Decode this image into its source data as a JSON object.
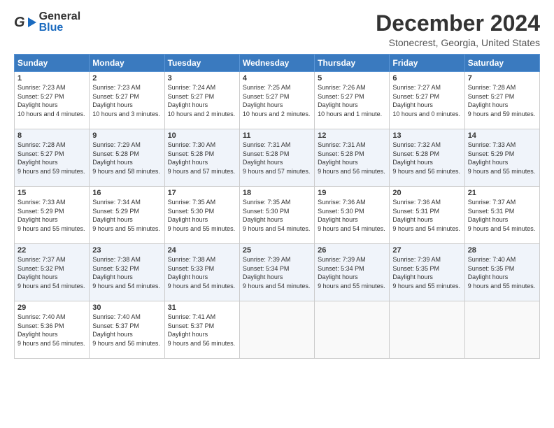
{
  "header": {
    "logo_general": "General",
    "logo_blue": "Blue",
    "title": "December 2024",
    "location": "Stonecrest, Georgia, United States"
  },
  "columns": [
    "Sunday",
    "Monday",
    "Tuesday",
    "Wednesday",
    "Thursday",
    "Friday",
    "Saturday"
  ],
  "weeks": [
    [
      {
        "day": "1",
        "sunrise": "7:23 AM",
        "sunset": "5:27 PM",
        "daylight": "10 hours and 4 minutes."
      },
      {
        "day": "2",
        "sunrise": "7:23 AM",
        "sunset": "5:27 PM",
        "daylight": "10 hours and 3 minutes."
      },
      {
        "day": "3",
        "sunrise": "7:24 AM",
        "sunset": "5:27 PM",
        "daylight": "10 hours and 2 minutes."
      },
      {
        "day": "4",
        "sunrise": "7:25 AM",
        "sunset": "5:27 PM",
        "daylight": "10 hours and 2 minutes."
      },
      {
        "day": "5",
        "sunrise": "7:26 AM",
        "sunset": "5:27 PM",
        "daylight": "10 hours and 1 minute."
      },
      {
        "day": "6",
        "sunrise": "7:27 AM",
        "sunset": "5:27 PM",
        "daylight": "10 hours and 0 minutes."
      },
      {
        "day": "7",
        "sunrise": "7:28 AM",
        "sunset": "5:27 PM",
        "daylight": "9 hours and 59 minutes."
      }
    ],
    [
      {
        "day": "8",
        "sunrise": "7:28 AM",
        "sunset": "5:27 PM",
        "daylight": "9 hours and 59 minutes."
      },
      {
        "day": "9",
        "sunrise": "7:29 AM",
        "sunset": "5:28 PM",
        "daylight": "9 hours and 58 minutes."
      },
      {
        "day": "10",
        "sunrise": "7:30 AM",
        "sunset": "5:28 PM",
        "daylight": "9 hours and 57 minutes."
      },
      {
        "day": "11",
        "sunrise": "7:31 AM",
        "sunset": "5:28 PM",
        "daylight": "9 hours and 57 minutes."
      },
      {
        "day": "12",
        "sunrise": "7:31 AM",
        "sunset": "5:28 PM",
        "daylight": "9 hours and 56 minutes."
      },
      {
        "day": "13",
        "sunrise": "7:32 AM",
        "sunset": "5:28 PM",
        "daylight": "9 hours and 56 minutes."
      },
      {
        "day": "14",
        "sunrise": "7:33 AM",
        "sunset": "5:29 PM",
        "daylight": "9 hours and 55 minutes."
      }
    ],
    [
      {
        "day": "15",
        "sunrise": "7:33 AM",
        "sunset": "5:29 PM",
        "daylight": "9 hours and 55 minutes."
      },
      {
        "day": "16",
        "sunrise": "7:34 AM",
        "sunset": "5:29 PM",
        "daylight": "9 hours and 55 minutes."
      },
      {
        "day": "17",
        "sunrise": "7:35 AM",
        "sunset": "5:30 PM",
        "daylight": "9 hours and 55 minutes."
      },
      {
        "day": "18",
        "sunrise": "7:35 AM",
        "sunset": "5:30 PM",
        "daylight": "9 hours and 54 minutes."
      },
      {
        "day": "19",
        "sunrise": "7:36 AM",
        "sunset": "5:30 PM",
        "daylight": "9 hours and 54 minutes."
      },
      {
        "day": "20",
        "sunrise": "7:36 AM",
        "sunset": "5:31 PM",
        "daylight": "9 hours and 54 minutes."
      },
      {
        "day": "21",
        "sunrise": "7:37 AM",
        "sunset": "5:31 PM",
        "daylight": "9 hours and 54 minutes."
      }
    ],
    [
      {
        "day": "22",
        "sunrise": "7:37 AM",
        "sunset": "5:32 PM",
        "daylight": "9 hours and 54 minutes."
      },
      {
        "day": "23",
        "sunrise": "7:38 AM",
        "sunset": "5:32 PM",
        "daylight": "9 hours and 54 minutes."
      },
      {
        "day": "24",
        "sunrise": "7:38 AM",
        "sunset": "5:33 PM",
        "daylight": "9 hours and 54 minutes."
      },
      {
        "day": "25",
        "sunrise": "7:39 AM",
        "sunset": "5:34 PM",
        "daylight": "9 hours and 54 minutes."
      },
      {
        "day": "26",
        "sunrise": "7:39 AM",
        "sunset": "5:34 PM",
        "daylight": "9 hours and 55 minutes."
      },
      {
        "day": "27",
        "sunrise": "7:39 AM",
        "sunset": "5:35 PM",
        "daylight": "9 hours and 55 minutes."
      },
      {
        "day": "28",
        "sunrise": "7:40 AM",
        "sunset": "5:35 PM",
        "daylight": "9 hours and 55 minutes."
      }
    ],
    [
      {
        "day": "29",
        "sunrise": "7:40 AM",
        "sunset": "5:36 PM",
        "daylight": "9 hours and 56 minutes."
      },
      {
        "day": "30",
        "sunrise": "7:40 AM",
        "sunset": "5:37 PM",
        "daylight": "9 hours and 56 minutes."
      },
      {
        "day": "31",
        "sunrise": "7:41 AM",
        "sunset": "5:37 PM",
        "daylight": "9 hours and 56 minutes."
      },
      null,
      null,
      null,
      null
    ]
  ],
  "labels": {
    "sunrise": "Sunrise:",
    "sunset": "Sunset:",
    "daylight": "Daylight hours"
  }
}
